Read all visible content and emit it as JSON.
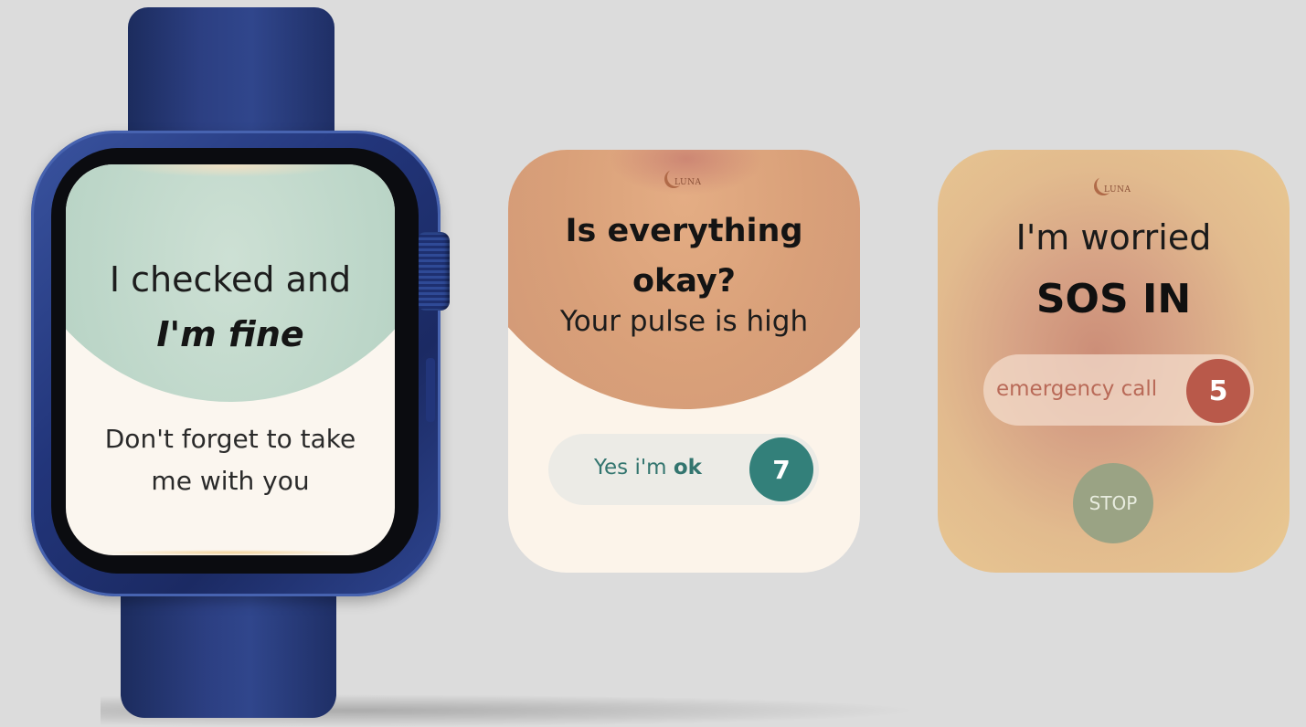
{
  "watch_screen": {
    "line1": "I checked and",
    "line2": "I'm fine",
    "message_line1": "Don't forget to take",
    "message_line2": "me with you"
  },
  "pulse_card": {
    "logo_text": "LUNA",
    "question_line1": "Is everything",
    "question_line2": "okay?",
    "subtitle": "Your pulse is high",
    "confirm_prefix": "Yes i'm ",
    "confirm_bold": "ok",
    "countdown": "7"
  },
  "sos_card": {
    "logo_text": "LUNA",
    "title": "I'm worried",
    "sos_label": "SOS IN",
    "call_label": "emergency call",
    "countdown": "5",
    "stop_label": "STOP"
  },
  "colors": {
    "watch_band": "#2c3f82",
    "watch_dome": "#bcd6c8",
    "pulse_dome": "#d9a079",
    "confirm_accent": "#33807a",
    "sos_accent": "#b9594a",
    "stop_button": "#9aa384",
    "cream": "#fcf4ea"
  }
}
